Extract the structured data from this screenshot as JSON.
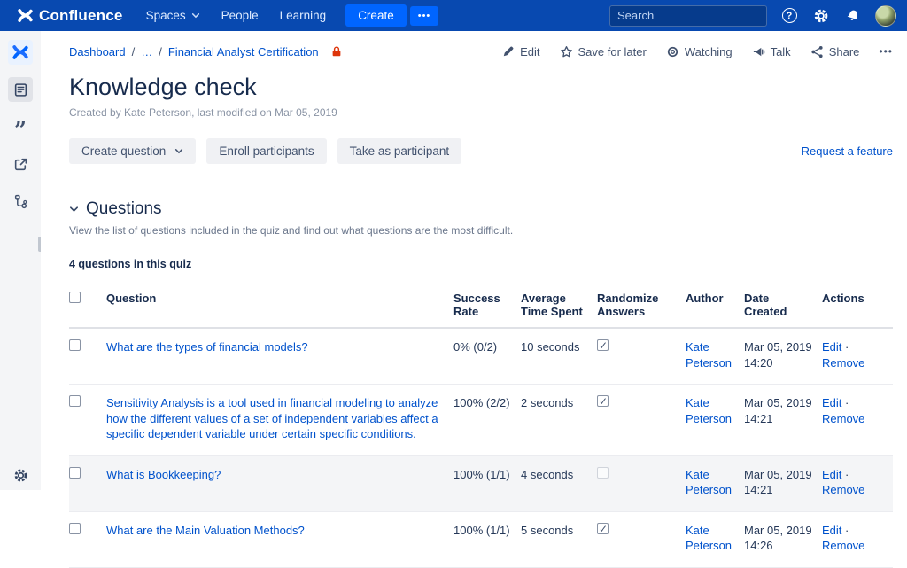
{
  "colors": {
    "navbar": "#0849B0",
    "accent": "#0052CC",
    "create_button": "#0065FF",
    "lock_red": "#DE350B",
    "shaded_row": "#F4F5F7"
  },
  "navbar": {
    "logo_text": "Confluence",
    "items": {
      "spaces": "Spaces",
      "people": "People",
      "learning": "Learning"
    },
    "create_label": "Create",
    "more_label": "•••",
    "search_placeholder": "Search",
    "help_glyph": "?"
  },
  "breadcrumb": {
    "dashboard": "Dashboard",
    "ellipsis": "…",
    "sep1": "/",
    "sep2": "/",
    "current": "Financial Analyst Certification"
  },
  "page_actions": {
    "edit": "Edit",
    "save": "Save for later",
    "watching": "Watching",
    "talk": "Talk",
    "share": "Share",
    "more": "•••"
  },
  "page": {
    "title": "Knowledge check",
    "byline": "Created by Kate Peterson, last modified on Mar 05, 2019"
  },
  "toolbar": {
    "create_question": "Create question",
    "enroll": "Enroll participants",
    "take": "Take as participant",
    "request_feature": "Request a feature"
  },
  "questions_section": {
    "heading": "Questions",
    "description": "View the list of questions included in the quiz and find out what questions are the most difficult.",
    "count_text": "4 questions in this quiz"
  },
  "table": {
    "headers": {
      "question": "Question",
      "success_rate": "Success Rate",
      "avg_time": "Average Time Spent",
      "randomize": "Randomize Answers",
      "author": "Author",
      "date_created": "Date Created",
      "actions": "Actions"
    },
    "action_labels": {
      "edit": "Edit",
      "separator": "·",
      "remove": "Remove"
    },
    "rows": [
      {
        "question": "What are the types of financial models?",
        "success_rate": "0% (0/2)",
        "avg_time": "10 seconds",
        "randomize": true,
        "author": "Kate Peterson",
        "date_created": "Mar 05, 2019 14:20"
      },
      {
        "question": "Sensitivity Analysis is a tool used in financial modeling to analyze how the different values of a set of independent variables affect a specific dependent variable under certain specific conditions.",
        "success_rate": "100% (2/2)",
        "avg_time": "2 seconds",
        "randomize": true,
        "author": "Kate Peterson",
        "date_created": "Mar 05, 2019 14:21"
      },
      {
        "question": "What is Bookkeeping?",
        "success_rate": "100% (1/1)",
        "avg_time": "4 seconds",
        "randomize": false,
        "author": "Kate Peterson",
        "date_created": "Mar 05, 2019 14:21"
      },
      {
        "question": "What are the Main Valuation Methods?",
        "success_rate": "100% (1/1)",
        "avg_time": "5 seconds",
        "randomize": true,
        "author": "Kate Peterson",
        "date_created": "Mar 05, 2019 14:26"
      }
    ]
  }
}
